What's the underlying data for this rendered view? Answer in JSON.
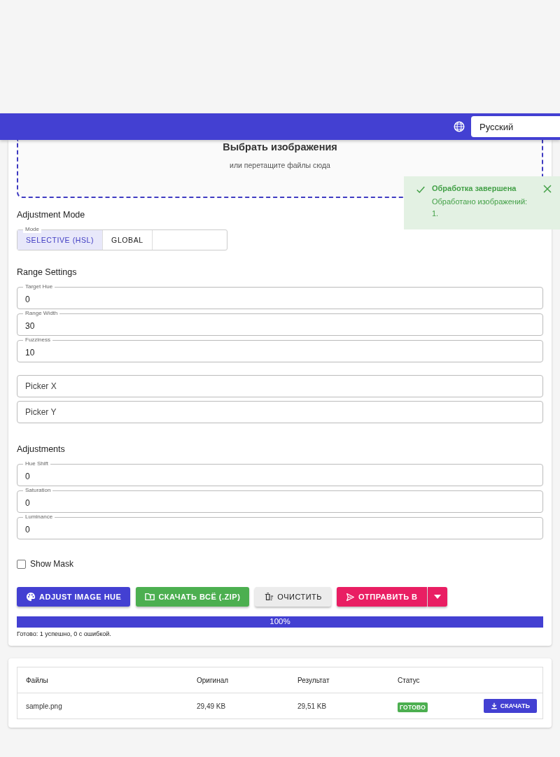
{
  "header": {
    "language": "Русский"
  },
  "dropzone": {
    "title": "Выбрать изображения",
    "hint": "или перетащите файлы сюда"
  },
  "toast": {
    "title": "Обработка завершена",
    "message": "Обработано изображений: 1."
  },
  "adjustment_mode": {
    "title": "Adjustment Mode",
    "label": "Mode",
    "options": [
      {
        "label": "SELECTIVE (HSL)",
        "selected": true
      },
      {
        "label": "GLOBAL",
        "selected": false
      }
    ]
  },
  "range_settings": {
    "title": "Range Settings",
    "fields": [
      {
        "label": "Target Hue",
        "value": "0"
      },
      {
        "label": "Range Width",
        "value": "30"
      },
      {
        "label": "Fuzziness",
        "value": "10"
      }
    ],
    "picker_fields": [
      {
        "placeholder": "Picker X"
      },
      {
        "placeholder": "Picker Y"
      }
    ]
  },
  "adjustments": {
    "title": "Adjustments",
    "fields": [
      {
        "label": "Hue Shift",
        "value": "0"
      },
      {
        "label": "Saturation",
        "value": "0"
      },
      {
        "label": "Luminance",
        "value": "0"
      }
    ]
  },
  "show_mask": {
    "label": "Show Mask",
    "checked": false
  },
  "buttons": [
    {
      "kind": "hue",
      "label": "ADJUST IMAGE HUE"
    },
    {
      "kind": "zip",
      "label": "СКАЧАТЬ ВСЁ (.ZIP)"
    },
    {
      "kind": "clear",
      "label": "ОЧИСТИТЬ"
    },
    {
      "kind": "send",
      "label": "ОТПРАВИТЬ В"
    }
  ],
  "progress": {
    "level": 1,
    "reading": "100%",
    "summary": "Готово: 1 успешно, 0 с ошибкой."
  },
  "table": {
    "columns": [
      "Файлы",
      "Оригинал",
      "Результат",
      "Статус"
    ],
    "rows": [
      {
        "file": "sample.png",
        "original": "29,49 KB",
        "result": "29,51 KB",
        "status": "ГОТОВО",
        "action": "СКАЧАТЬ"
      }
    ]
  }
}
